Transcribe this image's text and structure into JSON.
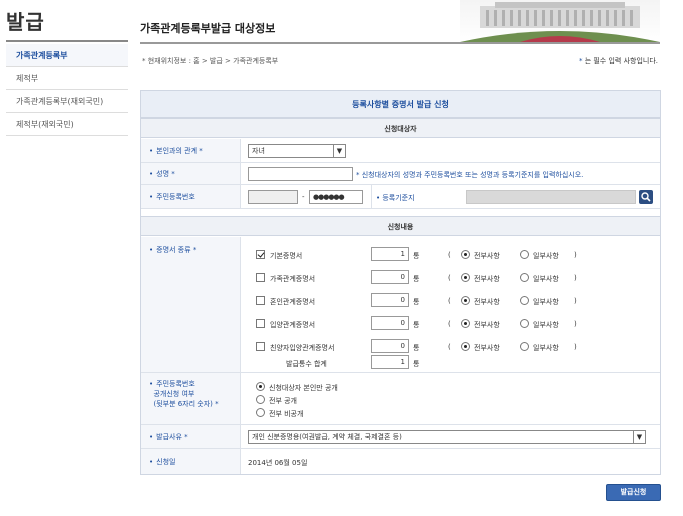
{
  "sidebar": {
    "title": "발급",
    "items": [
      {
        "label": "가족관계등록부",
        "active": true
      },
      {
        "label": "제적부",
        "active": false
      },
      {
        "label": "가족관계등록부(재외국민)",
        "active": false
      },
      {
        "label": "제적부(재외국민)",
        "active": false
      }
    ]
  },
  "header": {
    "title": "가족관계등록부발급 대상정보",
    "breadcrumb": "* 현재위치정보 : 홈 > 발급 > 가족관계등록부",
    "required_note_star": "*",
    "required_note": " 는 필수 입력 사항입니다."
  },
  "form": {
    "title": "등록사항별 증명서 발급 신청",
    "section_applicant": "신청대상자",
    "section_content": "신청내용",
    "relation": {
      "label": "본인과의 관계",
      "value": "자녀"
    },
    "name": {
      "label": "성명",
      "value": "",
      "hint": "* 신청대상자의 성명과 주민등록번호 또는 성명과 등록기준지를 입력하십시오."
    },
    "rrn": {
      "label": "주민등록번호",
      "front": "",
      "dash": "-",
      "back": "●●●●●●"
    },
    "domicile": {
      "label": "등록기준지",
      "value": ""
    },
    "cert": {
      "label": "증명서 종류",
      "unit": "통",
      "paren_open": "(",
      "paren_close": ")",
      "opt_all": "전부사항",
      "opt_part": "일부사항",
      "items": [
        {
          "name": "기본증명서",
          "checked": true,
          "count": "1"
        },
        {
          "name": "가족관계증명서",
          "checked": false,
          "count": "0"
        },
        {
          "name": "혼인관계증명서",
          "checked": false,
          "count": "0"
        },
        {
          "name": "입양관계증명서",
          "checked": false,
          "count": "0"
        },
        {
          "name": "친양자입양관계증명서",
          "checked": false,
          "count": "0"
        }
      ],
      "total_label": "발급통수 합계",
      "total": "1"
    },
    "disclosure": {
      "label_line1": "주민등록번호",
      "label_line2": "공개신청 여부",
      "label_line3": "(뒷부분 6자리 숫자)",
      "options": [
        "신청대상자 본인만 공개",
        "전부 공개",
        "전부 비공개"
      ],
      "selected": 0
    },
    "reason": {
      "label": "발급사유",
      "value": "개인 신분증명용(여권발급, 계약 체결, 국제결혼 등)"
    },
    "date": {
      "label": "신청일",
      "value": "2014년 06월 05일"
    },
    "submit": "발급신청"
  },
  "colors": {
    "accent": "#1d4e9e",
    "button": "#3a6ab4"
  }
}
